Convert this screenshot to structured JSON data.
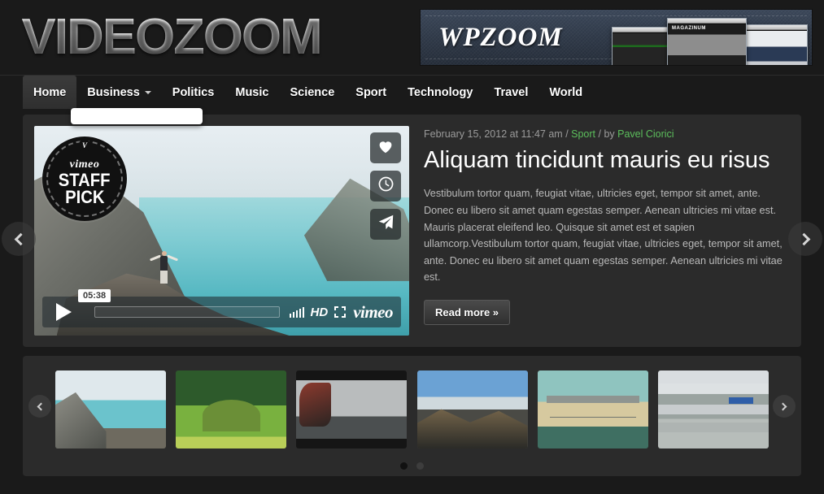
{
  "site": {
    "logo": "VIDEOZOOM"
  },
  "banner": {
    "name": "WPZOOM",
    "shot_title": "MAGAZINUM"
  },
  "nav": {
    "items": [
      {
        "label": "Home",
        "active": true,
        "has_dropdown": false
      },
      {
        "label": "Business",
        "active": false,
        "has_dropdown": true
      },
      {
        "label": "Politics",
        "active": false,
        "has_dropdown": false
      },
      {
        "label": "Music",
        "active": false,
        "has_dropdown": false
      },
      {
        "label": "Science",
        "active": false,
        "has_dropdown": false
      },
      {
        "label": "Sport",
        "active": false,
        "has_dropdown": false
      },
      {
        "label": "Technology",
        "active": false,
        "has_dropdown": false
      },
      {
        "label": "Travel",
        "active": false,
        "has_dropdown": false
      },
      {
        "label": "World",
        "active": false,
        "has_dropdown": false
      }
    ],
    "dropdown_item": ""
  },
  "slider": {
    "prev_label": "‹",
    "next_label": "›",
    "video": {
      "badge": {
        "brand": "vimeo",
        "line1": "STAFF",
        "line2": "PICK",
        "mark": "V"
      },
      "actions": [
        {
          "name": "like",
          "icon": "heart-icon"
        },
        {
          "name": "watch-later",
          "icon": "clock-icon"
        },
        {
          "name": "share",
          "icon": "paper-plane-icon"
        }
      ],
      "duration": "05:38",
      "quality": "HD",
      "player_logo": "vimeo"
    },
    "article": {
      "date": "February 15, 2012 at 11:47 am",
      "sep1": " / ",
      "category": "Sport",
      "sep2": " / by ",
      "author": "Pavel Ciorici",
      "title": "Aliquam tincidunt mauris eu risus",
      "excerpt": "Vestibulum tortor quam, feugiat vitae, ultricies eget, tempor sit amet, ante. Donec eu libero sit amet quam egestas semper. Aenean ultricies mi vitae est. Mauris placerat eleifend leo. Quisque sit amet est et sapien ullamcorp.Vestibulum tortor quam, feugiat vitae, ultricies eget, tempor sit amet, ante. Donec eu libero sit amet quam egestas semper. Aenean ultricies mi vitae est.",
      "read_more": "Read more »"
    }
  },
  "carousel": {
    "prev_label": "‹",
    "next_label": "›",
    "thumbs": [
      {
        "name": "thumb-fjord-hiker"
      },
      {
        "name": "thumb-green-hill"
      },
      {
        "name": "thumb-harbor-ship"
      },
      {
        "name": "thumb-mountain-valley"
      },
      {
        "name": "thumb-bridge"
      },
      {
        "name": "thumb-highway-interchange"
      }
    ],
    "dots": [
      {
        "active": true
      },
      {
        "active": false
      }
    ]
  },
  "colors": {
    "page_bg": "#1a1a1a",
    "panel_bg": "#2b2b2b",
    "accent_green": "#5cbf5c",
    "text": "#ffffff",
    "muted": "#9b9b9b"
  }
}
